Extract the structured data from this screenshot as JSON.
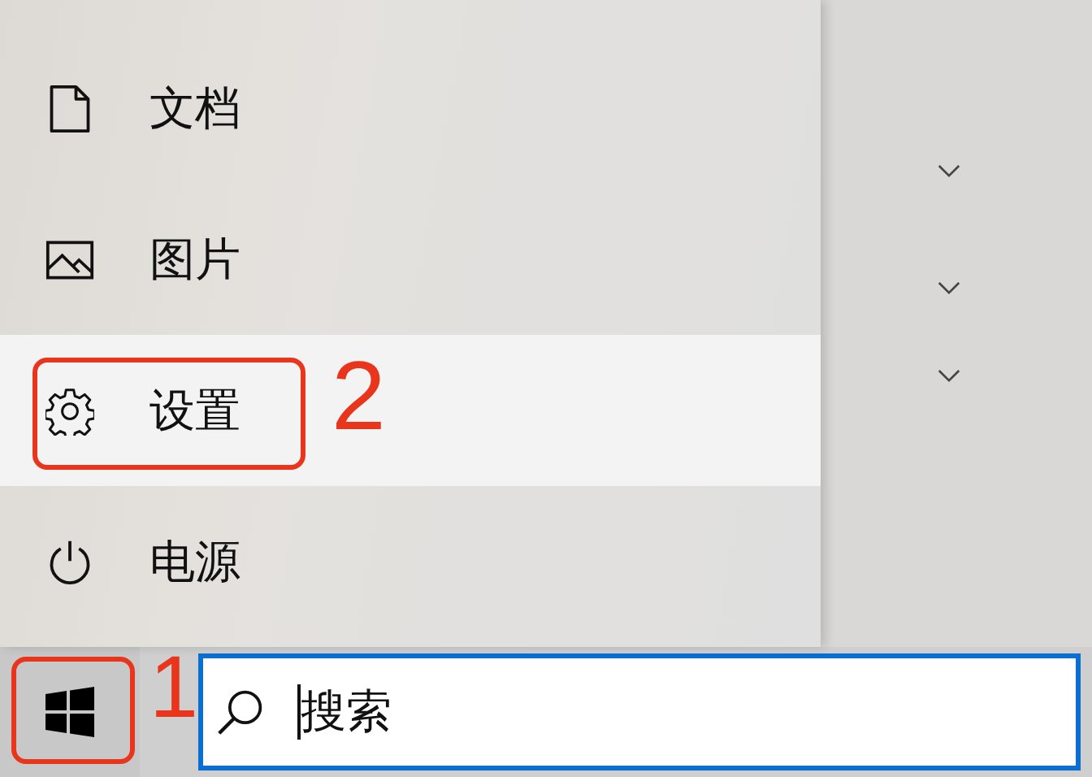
{
  "start_menu": {
    "items": [
      {
        "kind": "document",
        "label": "文档",
        "selected": false
      },
      {
        "kind": "picture",
        "label": "图片",
        "selected": false
      },
      {
        "kind": "settings",
        "label": "设置",
        "selected": true,
        "annotation": "2"
      },
      {
        "kind": "power",
        "label": "电源",
        "selected": false
      }
    ]
  },
  "right_panel": {
    "groups": [
      {
        "expanded": false
      },
      {
        "expanded": false
      },
      {
        "expanded": false
      }
    ]
  },
  "taskbar": {
    "start_button": {
      "annotation": "1"
    },
    "search": {
      "placeholder": "搜索"
    }
  }
}
